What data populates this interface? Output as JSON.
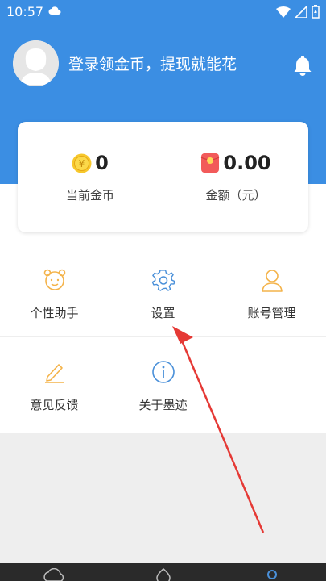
{
  "status_bar": {
    "time": "10:57"
  },
  "profile": {
    "login_prompt": "登录领金币，提现就能花"
  },
  "stats": {
    "coins_value": "0",
    "coins_label": "当前金币",
    "coin_symbol": "¥",
    "amount_value": "0.00",
    "amount_label": "金额（元）"
  },
  "menu": [
    {
      "label": "个性助手",
      "icon": "assistant-face-icon"
    },
    {
      "label": "设置",
      "icon": "gear-icon"
    },
    {
      "label": "账号管理",
      "icon": "user-icon"
    },
    {
      "label": "意见反馈",
      "icon": "pencil-icon"
    },
    {
      "label": "关于墨迹",
      "icon": "info-icon"
    }
  ],
  "colors": {
    "header_blue": "#3b8ee3",
    "icon_orange": "#f4b34a",
    "icon_blue": "#4a90d9",
    "arrow_red": "#e53935"
  }
}
